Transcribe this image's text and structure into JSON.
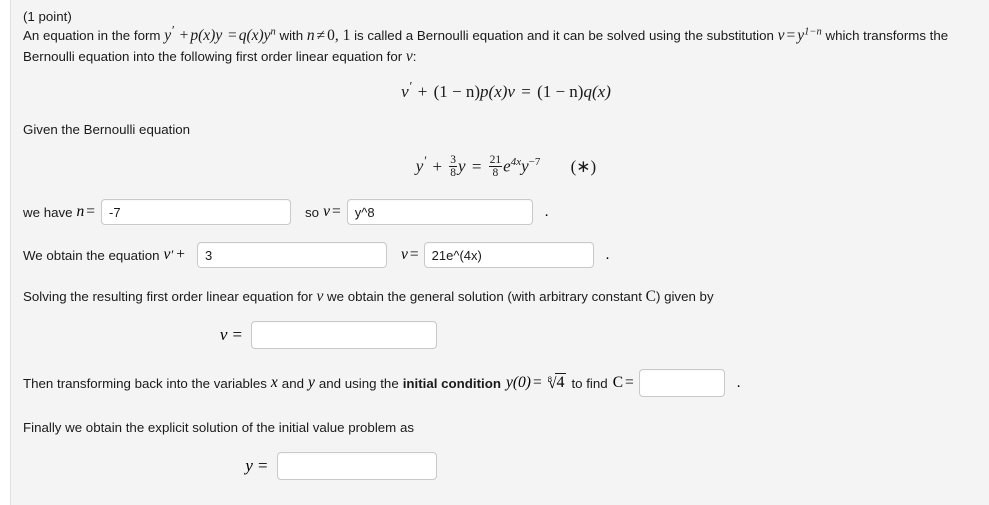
{
  "problem": {
    "points_label": "(1 point)",
    "intro_part1": "An equation in the form",
    "intro_eq_y": "y",
    "intro_eq_p": "p(x)y",
    "intro_eq_q": "q(x)y",
    "intro_eq_n_sup": "n",
    "intro_part2": "with",
    "intro_n": "n",
    "intro_neq": "≠",
    "intro_zero_one": "0, 1",
    "intro_part3": "is called a Bernoulli equation and it can be solved using the substitution",
    "intro_v": "v",
    "intro_eq_sign": "=",
    "intro_sub_y": "y",
    "intro_sub_exp": "1−n",
    "intro_part4": "which",
    "intro_line2": "transforms the Bernoulli equation into the following first order linear equation for",
    "intro_line2_v": "v",
    "intro_colon": ":",
    "display_eq1": {
      "v": "v",
      "plus": "+",
      "factor_open": "(1 − n)",
      "p": "p(x)v",
      "equals": "=",
      "factor_open2": "(1 − n)",
      "q": "q(x)"
    },
    "given_label": "Given the Bernoulli equation",
    "display_eq2": {
      "y": "y",
      "plus": "+",
      "frac1_num": "3",
      "frac1_den": "8",
      "y2": "y",
      "equals": "=",
      "frac2_num": "21",
      "frac2_den": "8",
      "e": "e",
      "e_exp": "4x",
      "y3": "y",
      "y3_exp": "−7",
      "star": "(∗)"
    },
    "row_n": {
      "prefix": "we have",
      "var": "n",
      "equals": "=",
      "value": "-7",
      "placeholder": "",
      "mid_text": "so",
      "mid_var": "v",
      "mid_equals": "=",
      "mid_value": "y^8",
      "mid_placeholder": "",
      "period": "."
    },
    "row_equation": {
      "prefix": "We obtain the equation",
      "var": "v",
      "plus": "+",
      "value1": "3",
      "placeholder1": "",
      "mid_var": "v",
      "equals": "=",
      "value2": "21e^(4x)",
      "placeholder2": "",
      "period": "."
    },
    "solving_text_a": "Solving the resulting first order linear equation for",
    "solving_var": "v",
    "solving_text_b": "we obtain the general solution (with arbitrary constant",
    "solving_const": "C",
    "solving_text_c": ") given by",
    "v_answer": {
      "label": "v",
      "equals": "=",
      "value": "",
      "placeholder": ""
    },
    "transform_text_a": "Then transforming back into the variables",
    "transform_x": "x",
    "transform_and": "and",
    "transform_y": "y",
    "transform_text_b": "and using the",
    "transform_bold": "initial condition",
    "transform_ic_y": "y(0)",
    "transform_ic_equals": "=",
    "transform_ic_root_index": "8",
    "transform_ic_radicand": "4",
    "transform_text_c": "to find",
    "transform_const": "C",
    "transform_equals": "=",
    "transform_value": "",
    "transform_placeholder": "",
    "transform_period": ".",
    "finally_text": "Finally we obtain the explicit solution of the initial value problem as",
    "y_answer": {
      "label": "y",
      "equals": "=",
      "value": "",
      "placeholder": ""
    }
  },
  "colors": {
    "panel_bg": "#f4f4f4",
    "page_bg": "#ffffff",
    "text": "#1a1a1a",
    "input_border": "#c9c9c9"
  }
}
